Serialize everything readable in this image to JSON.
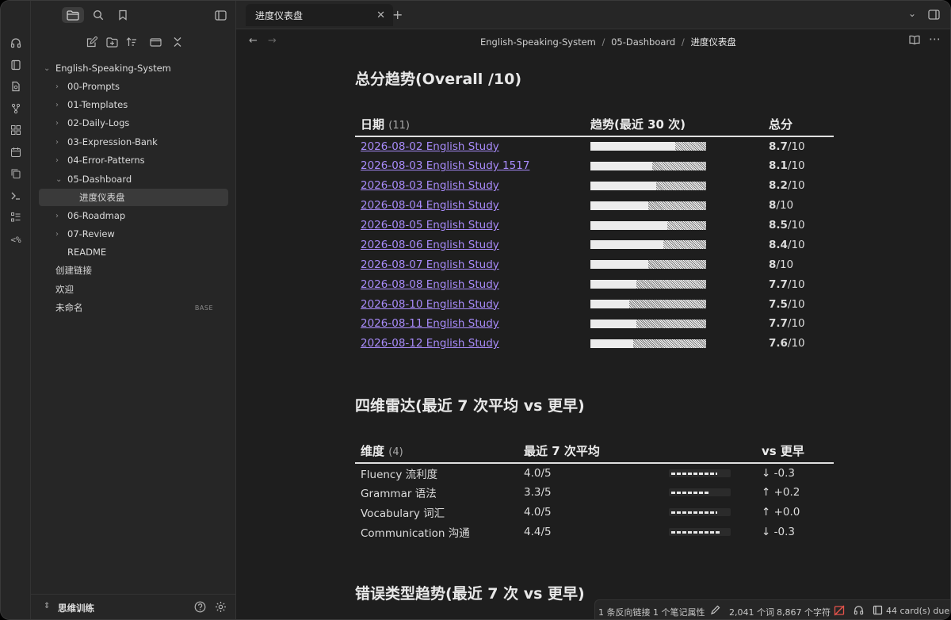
{
  "window": {
    "traffic_lights": {
      "close": "#ff5f57",
      "minimize": "#febc2e",
      "maximize": "#28c840"
    }
  },
  "tab": {
    "title": "进度仪表盘"
  },
  "breadcrumb": [
    "English-Speaking-System",
    "05-Dashboard",
    "进度仪表盘"
  ],
  "sidebar": {
    "vault": "English-Speaking-System",
    "items": [
      {
        "label": "00-Prompts"
      },
      {
        "label": "01-Templates"
      },
      {
        "label": "02-Daily-Logs"
      },
      {
        "label": "03-Expression-Bank"
      },
      {
        "label": "04-Error-Patterns"
      },
      {
        "label": "05-Dashboard"
      },
      {
        "label": "进度仪表盘"
      },
      {
        "label": "06-Roadmap"
      },
      {
        "label": "07-Review"
      },
      {
        "label": "README"
      },
      {
        "label": "创建链接"
      },
      {
        "label": "欢迎"
      },
      {
        "label": "未命名",
        "badge": "BASE"
      }
    ],
    "footer": {
      "vault_name": "思维训练"
    }
  },
  "sections": {
    "trend_title": "总分趋势(Overall /10)",
    "radar_title": "四维雷达(最近 7 次平均 vs 更早)",
    "error_title": "错误类型趋势(最近 7 次 vs 更早)"
  },
  "trend_table": {
    "headers": {
      "date": "日期",
      "count": "(11)",
      "trend": "趋势(最近 30 次)",
      "score": "总分"
    },
    "rows": [
      {
        "date": "2026-08-02 English Study",
        "score_num": "8.7",
        "score_suffix": "/10",
        "value": 8.7
      },
      {
        "date": "2026-08-03 English Study 1517",
        "score_num": "8.1",
        "score_suffix": "/10",
        "value": 8.1
      },
      {
        "date": "2026-08-03 English Study",
        "score_num": "8.2",
        "score_suffix": "/10",
        "value": 8.2
      },
      {
        "date": "2026-08-04 English Study",
        "score_num": "8",
        "score_suffix": "/10",
        "value": 8.0
      },
      {
        "date": "2026-08-05 English Study",
        "score_num": "8.5",
        "score_suffix": "/10",
        "value": 8.5
      },
      {
        "date": "2026-08-06 English Study",
        "score_num": "8.4",
        "score_suffix": "/10",
        "value": 8.4
      },
      {
        "date": "2026-08-07 English Study",
        "score_num": "8",
        "score_suffix": "/10",
        "value": 8.0
      },
      {
        "date": "2026-08-08 English Study",
        "score_num": "7.7",
        "score_suffix": "/10",
        "value": 7.7
      },
      {
        "date": "2026-08-10 English Study",
        "score_num": "7.5",
        "score_suffix": "/10",
        "value": 7.5
      },
      {
        "date": "2026-08-11 English Study",
        "score_num": "7.7",
        "score_suffix": "/10",
        "value": 7.7
      },
      {
        "date": "2026-08-12 English Study",
        "score_num": "7.6",
        "score_suffix": "/10",
        "value": 7.6
      }
    ]
  },
  "radar_table": {
    "headers": {
      "dim": "维度",
      "count": "(4)",
      "avg": "最近 7 次平均",
      "blank": "",
      "vs": "vs 更早"
    },
    "rows": [
      {
        "dim": "Fluency 流利度",
        "avg": "4.0/5",
        "value": 4.0,
        "vs": "↓ -0.3"
      },
      {
        "dim": "Grammar 语法",
        "avg": "3.3/5",
        "value": 3.3,
        "vs": "↑ +0.2"
      },
      {
        "dim": "Vocabulary 词汇",
        "avg": "4.0/5",
        "value": 4.0,
        "vs": "↑ +0.0"
      },
      {
        "dim": "Communication 沟通",
        "avg": "4.4/5",
        "value": 4.4,
        "vs": "↓ -0.3"
      }
    ]
  },
  "status_bar": {
    "backlinks": "1 条反向链接",
    "properties": "1 个笔记属性",
    "words": "2,041 个词",
    "chars": "8,867 个字符",
    "cards": "44 card(s) due"
  }
}
